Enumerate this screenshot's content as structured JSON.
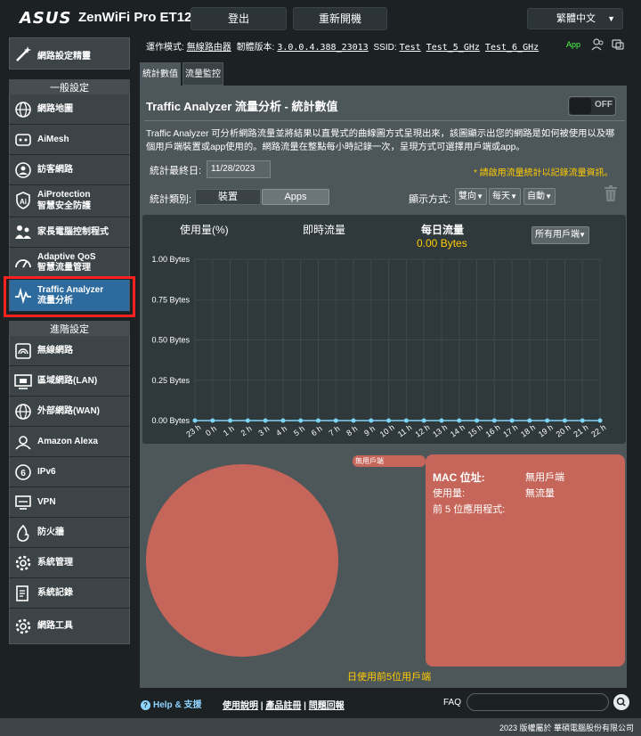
{
  "header": {
    "brand": "ASUS",
    "model": "ZenWiFi Pro ET12",
    "logout_label": "登出",
    "reboot_label": "重新開機",
    "language": "繁體中文"
  },
  "info_bar": {
    "mode_label": "運作模式:",
    "mode_value": "無線路由器",
    "firmware_label": "韌體版本:",
    "firmware_value": "3.0.0.4.388_23013",
    "ssid_label": "SSID:",
    "ssids": [
      "Test",
      "Test_5_GHz",
      "Test_6_GHz"
    ],
    "app_label": "App"
  },
  "sidebar": {
    "quick_setup": "網路設定精靈",
    "general_header": "一般設定",
    "general_items": [
      {
        "label": "網路地圖"
      },
      {
        "label": "AiMesh"
      },
      {
        "label": "訪客網路"
      },
      {
        "label": "AiProtection",
        "sub": "智慧安全防護"
      },
      {
        "label": "家長電腦控制程式"
      },
      {
        "label": "Adaptive QoS",
        "sub": "智慧流量管理"
      },
      {
        "label": "Traffic Analyzer",
        "sub": "流量分析"
      }
    ],
    "advanced_header": "進階設定",
    "advanced_items": [
      {
        "label": "無線網路"
      },
      {
        "label": "區域網路(LAN)"
      },
      {
        "label": "外部網路(WAN)"
      },
      {
        "label": "Amazon Alexa"
      },
      {
        "label": "IPv6"
      },
      {
        "label": "VPN"
      },
      {
        "label": "防火牆"
      },
      {
        "label": "系統管理"
      },
      {
        "label": "系統記錄"
      },
      {
        "label": "網路工具"
      }
    ]
  },
  "tabs": [
    "統計數值",
    "流量監控"
  ],
  "page": {
    "title": "Traffic Analyzer 流量分析 - 統計數值",
    "toggle_label": "OFF",
    "description": "Traffic Analyzer 可分析網路流量並將結果以直覺式的曲線圖方式呈現出來，該圖顯示出您的網路是如何被使用以及哪個用戶端裝置或app使用的。網路流量在整點每小時記錄一次，呈現方式可選擇用戶端或app。",
    "last_date_label": "統計最終日:",
    "last_date_value": "11/28/2023",
    "note": "* 請啟用流量統計以記錄流量資訊。",
    "category_label": "統計類別:",
    "category_device": "裝置",
    "category_apps": "Apps",
    "display_label": "顯示方式:",
    "display_direction": "雙向",
    "display_period": "每天",
    "display_mode": "自動",
    "chart_tabs": [
      "使用量(%)",
      "即時流量",
      "每日流量"
    ],
    "daily_value": "0.00 Bytes",
    "client_filter": "所有用戶端",
    "pie_label": "無用戶端",
    "mac_label": "MAC 位址:",
    "mac_value": "無用戶端",
    "usage_label": "使用量:",
    "usage_value": "無流量",
    "top_apps_label": "前 5 位應用程式:",
    "top5_title": "日使用前5位用戶端"
  },
  "chart_data": {
    "type": "line",
    "title": "",
    "xlabel": "",
    "ylabel": "",
    "ylim": [
      0,
      1
    ],
    "y_tick_labels": [
      "1.00 Bytes",
      "0.75 Bytes",
      "0.50 Bytes",
      "0.25 Bytes",
      "0.00 Bytes"
    ],
    "categories": [
      "23 h",
      "0 h",
      "1 h",
      "2 h",
      "3 h",
      "4 h",
      "5 h",
      "6 h",
      "7 h",
      "8 h",
      "9 h",
      "10 h",
      "11 h",
      "12 h",
      "13 h",
      "14 h",
      "15 h",
      "16 h",
      "17 h",
      "18 h",
      "19 h",
      "20 h",
      "21 h",
      "22 h"
    ],
    "series": [
      {
        "values": [
          0,
          0,
          0,
          0,
          0,
          0,
          0,
          0,
          0,
          0,
          0,
          0,
          0,
          0,
          0,
          0,
          0,
          0,
          0,
          0,
          0,
          0,
          0,
          0
        ],
        "color": "#7fd4f5"
      }
    ],
    "grid": true
  },
  "footer": {
    "help": "Help & 支援",
    "manual": "使用說明",
    "register": "產品註冊",
    "feedback": "問題回報",
    "faq": "FAQ",
    "copyright": "2023 版權屬於 華碩電腦股份有限公司"
  }
}
